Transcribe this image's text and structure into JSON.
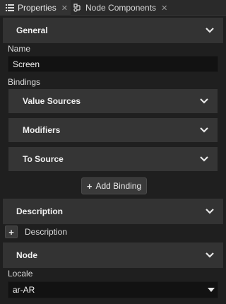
{
  "tabs": [
    {
      "label": "Properties",
      "icon": "list-icon",
      "close": "✕"
    },
    {
      "label": "Node Components",
      "icon": "components-icon",
      "close": "✕"
    }
  ],
  "sections": {
    "general": {
      "title": "General"
    },
    "description": {
      "title": "Description"
    },
    "node": {
      "title": "Node"
    }
  },
  "general": {
    "name_label": "Name",
    "name_value": "Screen",
    "bindings_label": "Bindings",
    "bindings": [
      {
        "title": "Value Sources"
      },
      {
        "title": "Modifiers"
      },
      {
        "title": "To Source"
      }
    ],
    "add_binding_label": "Add Binding",
    "add_binding_plus": "+"
  },
  "description": {
    "add_plus": "+",
    "add_label": "Description"
  },
  "node": {
    "locale_label": "Locale",
    "locale_value": "ar-AR"
  },
  "colors": {
    "background": "#1f1f1f",
    "section_bar": "#333333",
    "field_bg": "#121212",
    "text": "#e6e6e6"
  }
}
